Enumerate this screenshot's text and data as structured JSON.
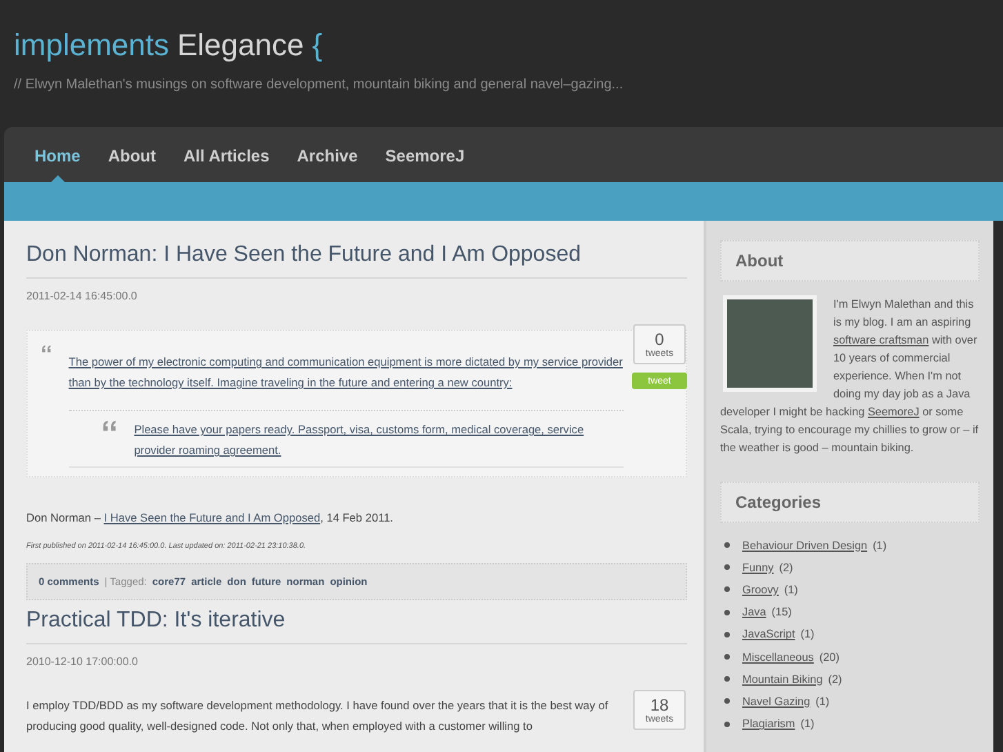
{
  "header": {
    "keyword": "implements",
    "name": "Elegance",
    "brace": "{",
    "tagline": "// Elwyn Malethan's musings on software development, mountain biking and general navel–gazing..."
  },
  "nav": {
    "items": [
      {
        "label": "Home",
        "selected": true
      },
      {
        "label": "About",
        "selected": false
      },
      {
        "label": "All Articles",
        "selected": false
      },
      {
        "label": "Archive",
        "selected": false
      },
      {
        "label": "SeemoreJ",
        "selected": false
      }
    ]
  },
  "posts": [
    {
      "title": "Don Norman: I Have Seen the Future and I Am Opposed",
      "date": "2011-02-14 16:45:00.0",
      "tweets": {
        "count": "0",
        "unit": "tweets",
        "button": "tweet"
      },
      "quote": {
        "text": "The power of my electronic computing and communication equipment is more dictated by my service provider than by the technology itself. Imagine traveling in the future and entering a new country:",
        "nested": "Please have your papers ready. Passport, visa, customs form, medical coverage, service provider roaming agreement."
      },
      "citation": [
        "Don Norman – ",
        "I Have Seen the Future and I Am Opposed",
        ", 14 Feb 2011."
      ],
      "meta": "First published on 2011-02-14 16:45:00.0. Last updated on: 2011-02-21 23:10:38.0.",
      "footer": {
        "comments": "0 comments",
        "separator": "| Tagged:",
        "tags": [
          "core77",
          "article",
          "don",
          "future",
          "norman",
          "opinion"
        ]
      }
    },
    {
      "title": "Practical TDD: It's iterative",
      "date": "2010-12-10 17:00:00.0",
      "tweets": {
        "count": "18",
        "unit": "tweets"
      },
      "paragraph": "I employ TDD/BDD as my software development methodology. I have found over the years that it is the best way of producing good quality, well-designed code. Not only that, when employed with a customer willing to"
    }
  ],
  "sidebar": {
    "about": {
      "heading": "About",
      "text": [
        "I'm Elwyn Malethan and this is my blog. I am an aspiring ",
        "software craftsman",
        " with over 10 years of commercial experience. When I'm not doing my day job as a Java developer I might be hacking ",
        "SeemoreJ",
        " or some Scala, trying to encourage my chillies to grow or – if the weather is good – mountain biking."
      ]
    },
    "categories": {
      "heading": "Categories",
      "items": [
        {
          "name": "Behaviour Driven Design",
          "count": "(1)"
        },
        {
          "name": "Funny",
          "count": "(2)"
        },
        {
          "name": "Groovy",
          "count": "(1)"
        },
        {
          "name": "Java",
          "count": "(15)"
        },
        {
          "name": "JavaScript",
          "count": "(1)"
        },
        {
          "name": "Miscellaneous",
          "count": "(20)"
        },
        {
          "name": "Mountain Biking",
          "count": "(2)"
        },
        {
          "name": "Navel Gazing",
          "count": "(1)"
        },
        {
          "name": "Plagiarism",
          "count": "(1)"
        }
      ]
    }
  }
}
